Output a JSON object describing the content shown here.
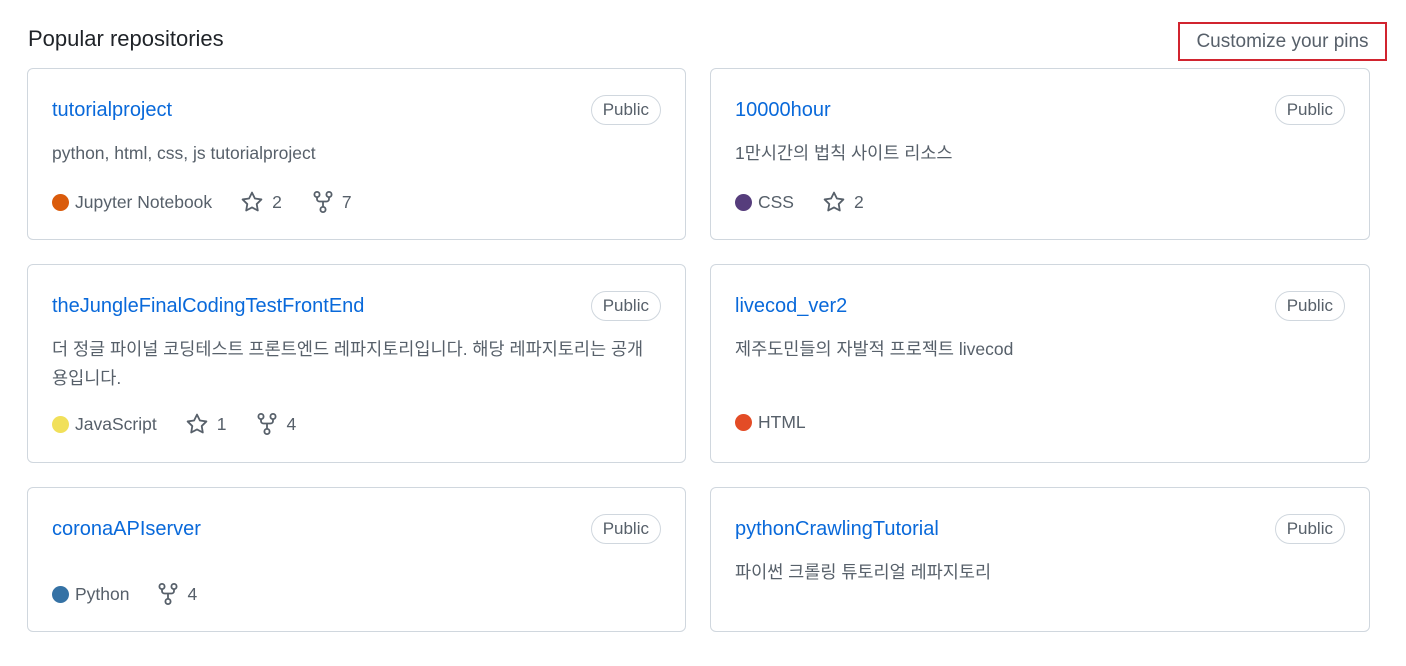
{
  "section": {
    "title": "Popular repositories",
    "customize_label": "Customize your pins"
  },
  "repos": [
    {
      "name": "tutorialproject",
      "visibility": "Public",
      "description": "python, html, css, js tutorialproject",
      "language": "Jupyter Notebook",
      "language_color": "#DA5B0B",
      "stars": "2",
      "forks": "7"
    },
    {
      "name": "10000hour",
      "visibility": "Public",
      "description": "1만시간의 법칙 사이트 리소스",
      "language": "CSS",
      "language_color": "#563D7C",
      "stars": "2"
    },
    {
      "name": "theJungleFinalCodingTestFrontEnd",
      "visibility": "Public",
      "description": "더 정글 파이널 코딩테스트 프론트엔드 레파지토리입니다. 해당 레파지토리는 공개용입니다.",
      "language": "JavaScript",
      "language_color": "#F1E05A",
      "stars": "1",
      "forks": "4"
    },
    {
      "name": "livecod_ver2",
      "visibility": "Public",
      "description": "제주도민들의 자발적 프로젝트 livecod",
      "language": "HTML",
      "language_color": "#E34C26"
    },
    {
      "name": "coronaAPIserver",
      "visibility": "Public",
      "language": "Python",
      "language_color": "#3572A5",
      "forks": "4"
    },
    {
      "name": "pythonCrawlingTutorial",
      "visibility": "Public",
      "description": "파이썬 크롤링 튜토리얼 레파지토리"
    }
  ],
  "icons": {
    "star": "star-icon",
    "fork": "repo-forked-icon"
  },
  "colors": {
    "link": "#0969DA",
    "border": "#D0D7DE",
    "muted": "#57606A",
    "highlight": "#D1242F"
  }
}
